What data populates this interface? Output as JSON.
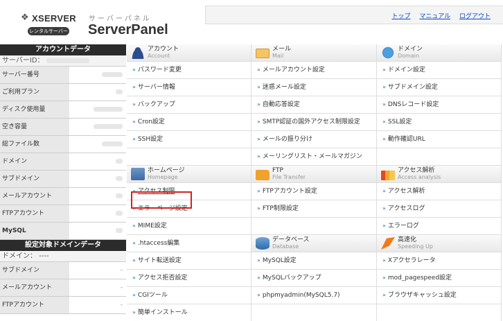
{
  "header": {
    "logo_text": "XSERVER",
    "logo_badge": "レンタルサーバー",
    "subtitle": "サーバーパネル",
    "title": "ServerPanel",
    "links": [
      "トップ",
      "マニュアル",
      "ログアウト"
    ]
  },
  "sidebar": {
    "account_head": "アカウントデータ",
    "server_id_label": "サーバーID：",
    "account_rows": [
      {
        "label": "サーバー番号"
      },
      {
        "label": "ご利用プラン"
      },
      {
        "label": "ディスク使用量"
      },
      {
        "label": "空き容量"
      },
      {
        "label": "総ファイル数"
      },
      {
        "label": "ドメイン"
      },
      {
        "label": "サブドメイン"
      },
      {
        "label": "メールアカウント"
      },
      {
        "label": "FTPアカウント"
      },
      {
        "label": "MySQL"
      }
    ],
    "domain_head": "設定対象ドメインデータ",
    "domain_label": "ドメイン：",
    "domain_value": "----",
    "domain_rows": [
      {
        "label": "サブドメイン",
        "value": "-"
      },
      {
        "label": "メールアカウント",
        "value": "-"
      },
      {
        "label": "FTPアカウント",
        "value": "-"
      }
    ]
  },
  "sections": {
    "account": {
      "title": "アカウント",
      "en": "Account",
      "icon": "user-icon"
    },
    "mail": {
      "title": "メール",
      "en": "Mail",
      "icon": "mail-icon"
    },
    "domain": {
      "title": "ドメイン",
      "en": "Domain",
      "icon": "globe-icon"
    },
    "homepage": {
      "title": "ホームページ",
      "en": "Homepage",
      "icon": "home-icon"
    },
    "ftp": {
      "title": "FTP",
      "en": "File Transfer",
      "icon": "folder-icon"
    },
    "analysis": {
      "title": "アクセス解析",
      "en": "Access analysis",
      "icon": "chart-icon"
    },
    "database": {
      "title": "データベース",
      "en": "Database",
      "icon": "database-icon"
    },
    "speed": {
      "title": "高速化",
      "en": "Speeding Up",
      "icon": "speed-icon"
    }
  },
  "links": {
    "account": [
      "パスワード変更",
      "サーバー情報",
      "バックアップ",
      "Cron設定",
      "SSH設定"
    ],
    "mail": [
      "メールアカウント設定",
      "迷惑メール設定",
      "自動応答設定",
      "SMTP認証の国外アクセス制限設定",
      "メールの振り分け",
      "メーリングリスト・メールマガジン"
    ],
    "domain": [
      "ドメイン設定",
      "サブドメイン設定",
      "DNSレコード設定",
      "SSL設定",
      "動作確認URL"
    ],
    "homepage": [
      "アクセス制限",
      "エラーページ設定",
      "MIME設定",
      ".htaccess編集",
      "サイト転送設定",
      "アクセス拒否設定",
      "CGIツール",
      "簡単インストール"
    ],
    "ftp": [
      "FTPアカウント設定",
      "FTP制限設定"
    ],
    "analysis": [
      "アクセス解析",
      "アクセスログ",
      "エラーログ"
    ],
    "database": [
      "MySQL設定",
      "MySQLバックアップ",
      "phpmyadmin(MySQL5.7)"
    ],
    "speed": [
      "Xアクセラレータ",
      "mod_pagespeed設定",
      "ブラウザキャッシュ設定"
    ]
  },
  "colors": {
    "accent_link": "#0645c8",
    "highlight": "#d6201f",
    "sidebar_head": "#2b2b2b"
  }
}
